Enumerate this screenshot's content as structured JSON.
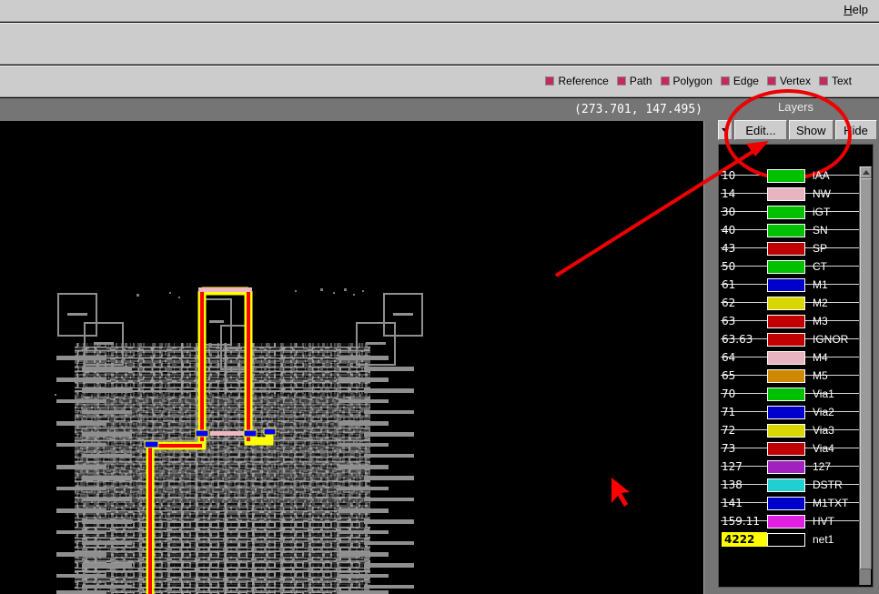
{
  "menubar": {
    "help_label": "Help",
    "help_mnemonic": "H"
  },
  "legend": {
    "items": [
      {
        "label": "Reference",
        "color": "#c42a62",
        "icon": "swatch-icon"
      },
      {
        "label": "Path",
        "color": "#c42a62",
        "icon": "swatch-icon"
      },
      {
        "label": "Polygon",
        "color": "#c42a62",
        "icon": "swatch-icon"
      },
      {
        "label": "Edge",
        "color": "#c42a62",
        "icon": "swatch-icon"
      },
      {
        "label": "Vertex",
        "color": "#c42a62",
        "icon": "swatch-icon"
      },
      {
        "label": "Text",
        "color": "#c42a62",
        "icon": "swatch-icon"
      }
    ]
  },
  "status": {
    "coordinates": "(273.701, 147.495)"
  },
  "layers_panel": {
    "title": "Layers",
    "dropdown_icon": "chevron-down-icon",
    "edit_label": "Edit...",
    "show_label": "Show",
    "hide_label": "Hide",
    "rows": [
      {
        "number": "10",
        "name": "iAA",
        "color": "#00c000",
        "selected": false
      },
      {
        "number": "14",
        "name": "NW",
        "color": "#e8b4c0",
        "selected": false
      },
      {
        "number": "30",
        "name": "iGT",
        "color": "#00c000",
        "selected": false
      },
      {
        "number": "40",
        "name": "SN",
        "color": "#00c000",
        "selected": false
      },
      {
        "number": "43",
        "name": "SP",
        "color": "#c00000",
        "selected": false
      },
      {
        "number": "50",
        "name": "CT",
        "color": "#00c000",
        "selected": false
      },
      {
        "number": "61",
        "name": "M1",
        "color": "#0000cc",
        "selected": false
      },
      {
        "number": "62",
        "name": "M2",
        "color": "#d8d800",
        "selected": false
      },
      {
        "number": "63",
        "name": "M3",
        "color": "#c00000",
        "selected": false
      },
      {
        "number": "63.63",
        "name": "IGNOR",
        "color": "#c00000",
        "selected": false
      },
      {
        "number": "64",
        "name": "M4",
        "color": "#e8b4c0",
        "selected": false
      },
      {
        "number": "65",
        "name": "M5",
        "color": "#d08800",
        "selected": false
      },
      {
        "number": "70",
        "name": "Via1",
        "color": "#00c000",
        "selected": false
      },
      {
        "number": "71",
        "name": "Via2",
        "color": "#0000cc",
        "selected": false
      },
      {
        "number": "72",
        "name": "Via3",
        "color": "#d8d800",
        "selected": false
      },
      {
        "number": "73",
        "name": "Via4",
        "color": "#c00000",
        "selected": false
      },
      {
        "number": "127",
        "name": "127",
        "color": "#a020c0",
        "selected": false
      },
      {
        "number": "138",
        "name": "DSTR",
        "color": "#20d0d0",
        "selected": false
      },
      {
        "number": "141",
        "name": "M1TXT",
        "color": "#0000cc",
        "selected": false
      },
      {
        "number": "159.11",
        "name": "HVT",
        "color": "#e020e0",
        "selected": false
      },
      {
        "number": "4222",
        "name": "net1",
        "color": "#000000",
        "selected": true
      }
    ],
    "scrollbar": {
      "up_icon": "scroll-up-arrow-icon"
    }
  },
  "canvas": {
    "background": "#000000",
    "highlight_net_color": "#ff0000",
    "highlight_outline_color": "#ffff00",
    "via_marker_color": "#0000ff",
    "cursor_icon": "mouse-cursor-arrow-icon",
    "cursor_color": "#ff0000"
  },
  "annotation": {
    "circle_icon": "annotation-ellipse-icon",
    "arrow_icon": "annotation-arrow-icon",
    "color": "#ee0000"
  }
}
